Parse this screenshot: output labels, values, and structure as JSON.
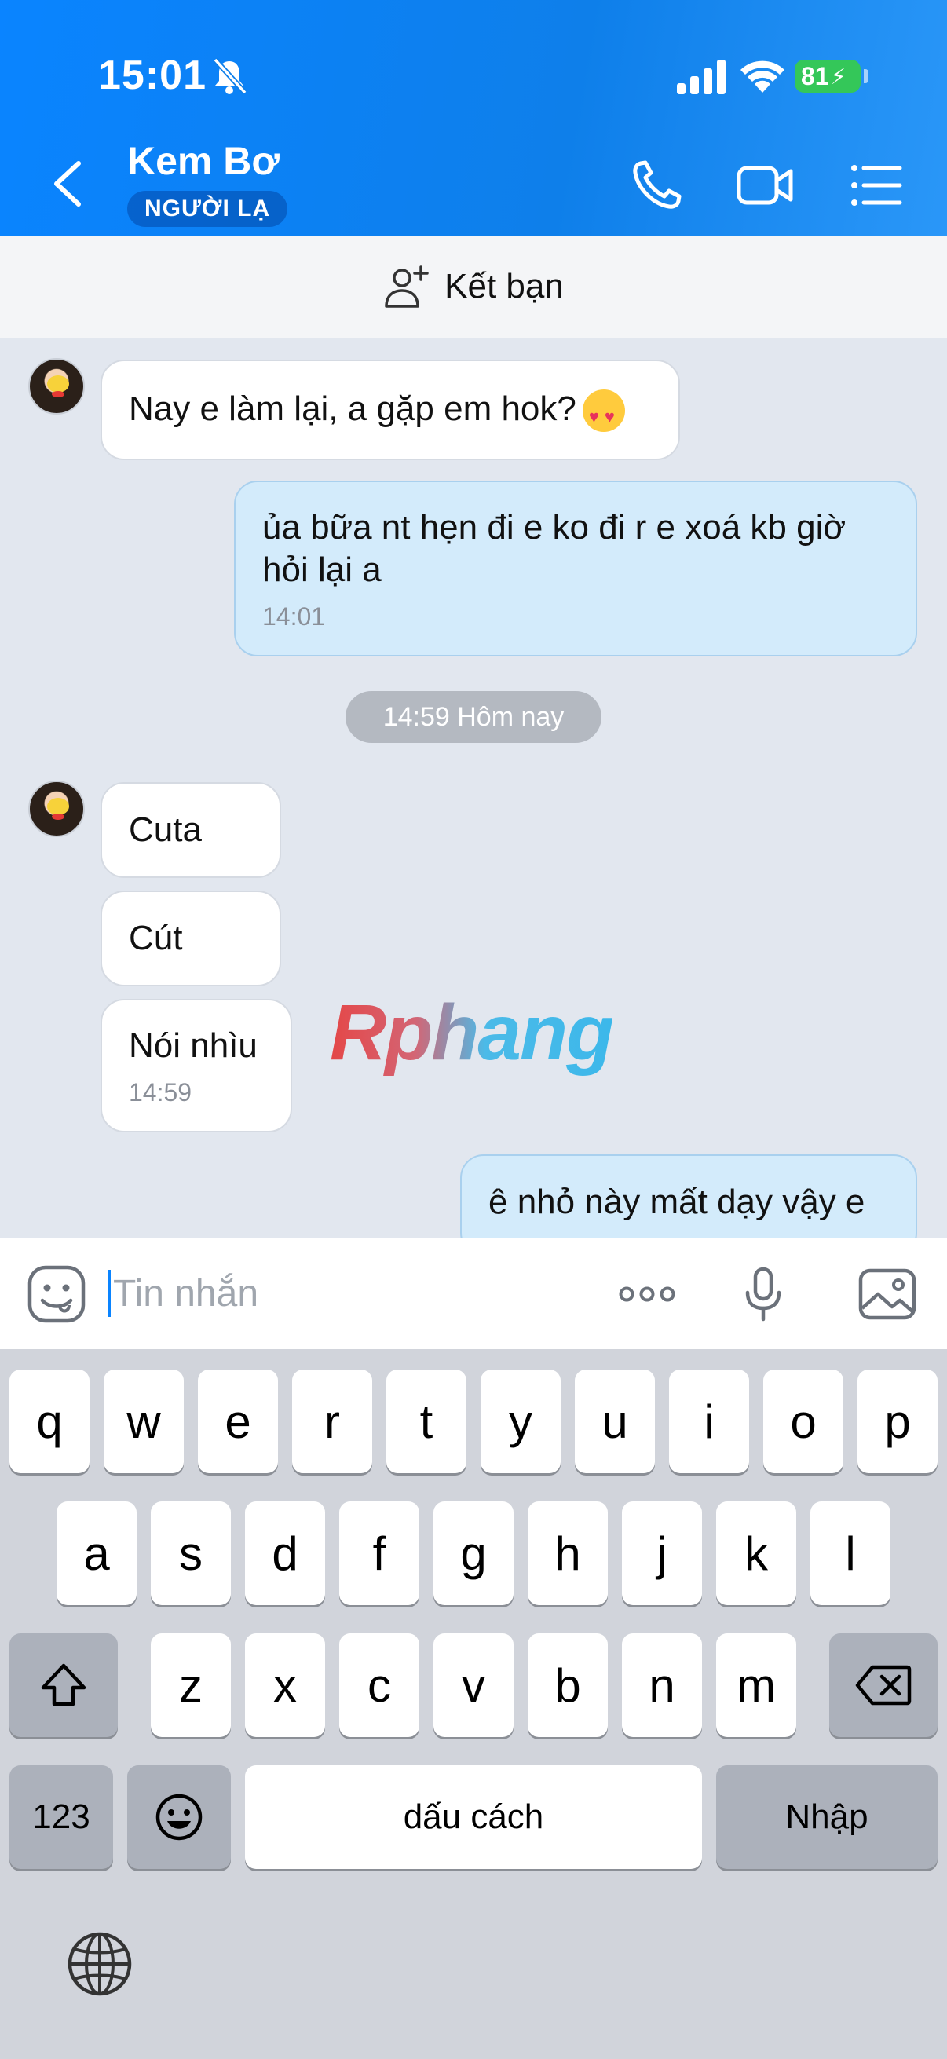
{
  "status_bar": {
    "time": "15:01",
    "battery": "81"
  },
  "header": {
    "contact_name": "Kem Bơ",
    "badge": "NGƯỜI LẠ"
  },
  "add_friend": {
    "label": "Kết bạn"
  },
  "messages": [
    {
      "direction": "in",
      "text": "Nay e làm lại, a gặp em hok?"
    },
    {
      "direction": "out",
      "text": "ủa bữa nt hẹn đi e ko đi r e xoá kb giờ hỏi lại a",
      "time": "14:01"
    },
    {
      "direction": "in",
      "text": "Cuta"
    },
    {
      "direction": "in",
      "text": "Cút"
    },
    {
      "direction": "in",
      "text": "Nói nhìu",
      "time": "14:59"
    },
    {
      "direction": "out",
      "text": "ê nhỏ này mất dạy vậy e"
    }
  ],
  "time_separator": "14:59 Hôm nay",
  "watermark": "Rphang",
  "composer": {
    "placeholder": "Tin nhắn",
    "value": ""
  },
  "keyboard": {
    "row1": [
      "q",
      "w",
      "e",
      "r",
      "t",
      "y",
      "u",
      "i",
      "o",
      "p"
    ],
    "row2": [
      "a",
      "s",
      "d",
      "f",
      "g",
      "h",
      "j",
      "k",
      "l"
    ],
    "row3": [
      "z",
      "x",
      "c",
      "v",
      "b",
      "n",
      "m"
    ],
    "numbers_label": "123",
    "space_label": "dấu cách",
    "return_label": "Nhập"
  },
  "colors": {
    "header": "#0a84ff",
    "bubble_out": "#d3ebfb",
    "bubble_in": "#ffffff",
    "chat_bg": "#e2e7ef",
    "battery": "#34c759"
  }
}
